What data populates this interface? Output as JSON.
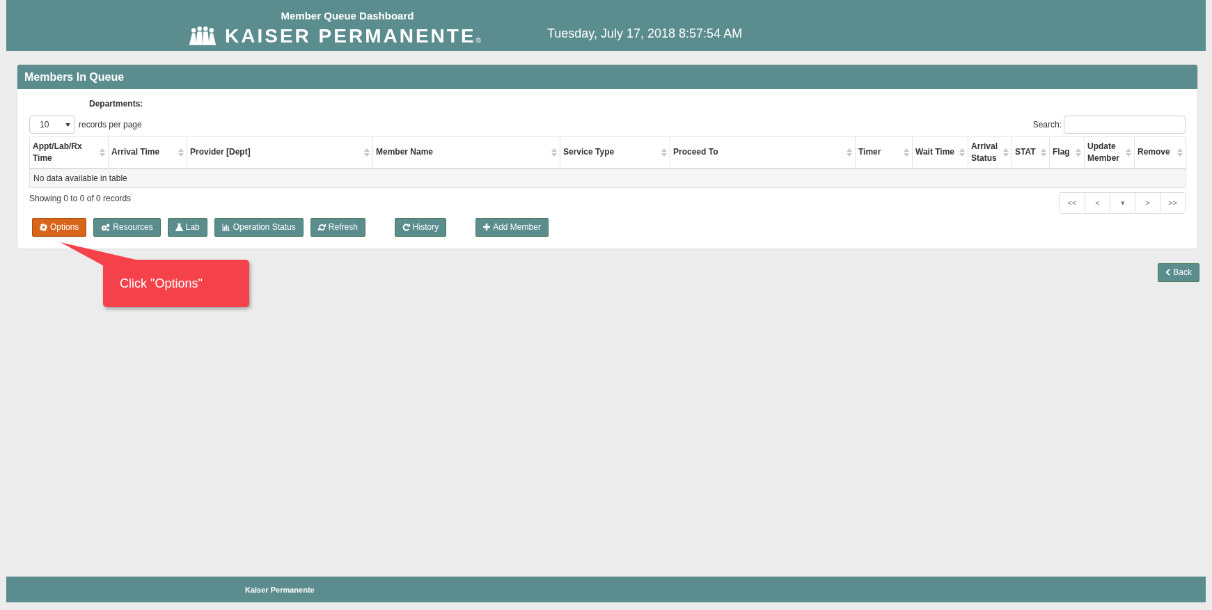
{
  "header": {
    "title": "Member Queue Dashboard",
    "logo_text": "KAISER PERMANENTE",
    "logo_mark": "®",
    "datetime": "Tuesday, July 17, 2018 8:57:54 AM"
  },
  "panel": {
    "title": "Members In Queue",
    "departments_label": "Departments:",
    "page_size": {
      "value": "10",
      "label": "records per page"
    },
    "search": {
      "label": "Search:"
    },
    "table": {
      "columns": [
        {
          "label": "Appt/Lab/Rx Time"
        },
        {
          "label": "Arrival Time"
        },
        {
          "label": "Provider [Dept]"
        },
        {
          "label": "Member Name"
        },
        {
          "label": "Service Type"
        },
        {
          "label": "Proceed To"
        },
        {
          "label": "Timer"
        },
        {
          "label": "Wait Time"
        },
        {
          "label": "Arrival Status"
        },
        {
          "label": "STAT"
        },
        {
          "label": "Flag"
        },
        {
          "label": "Update Member"
        },
        {
          "label": "Remove"
        }
      ],
      "empty_message": "No data available in table"
    },
    "info": "Showing 0 to 0 of 0 records",
    "pagination": [
      "<<",
      "<",
      "▾",
      ">",
      ">>"
    ],
    "button_groups": [
      [
        {
          "label": "Options",
          "highlighted": true
        },
        {
          "label": "Resources",
          "highlighted": false
        },
        {
          "label": "Lab",
          "highlighted": false
        },
        {
          "label": "Operation Status",
          "highlighted": false
        },
        {
          "label": "Refresh",
          "highlighted": false
        }
      ],
      [
        {
          "label": "History",
          "highlighted": false
        }
      ],
      [
        {
          "label": "Add Member",
          "highlighted": false
        }
      ]
    ]
  },
  "callout": {
    "text": "Click \"Options\""
  },
  "back_button": {
    "label": "Back"
  },
  "footer": {
    "text": "Kaiser Permanente"
  }
}
